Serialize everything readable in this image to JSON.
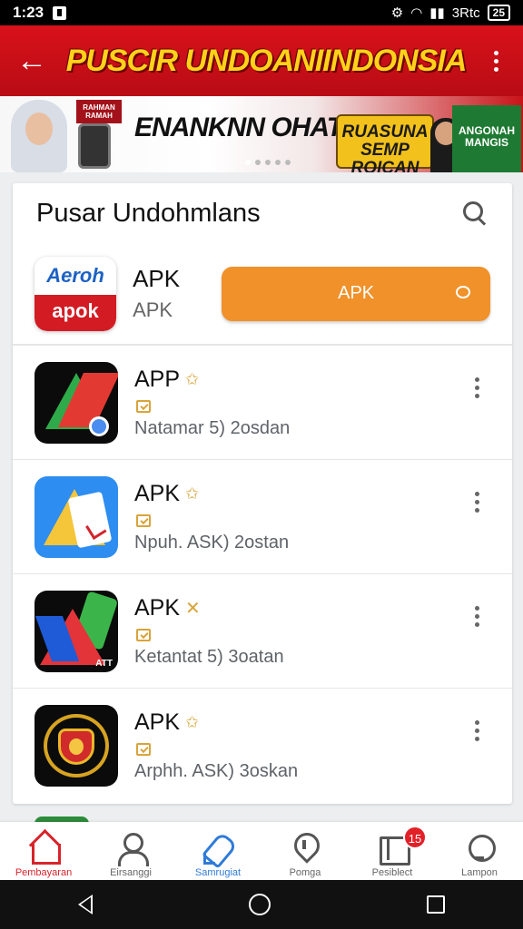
{
  "status": {
    "time": "1:23",
    "network_label": "3Rtc",
    "battery": "25"
  },
  "header": {
    "title": "PUSCIR UNDOANIINDONSIA"
  },
  "banner": {
    "left_badge": "RAHMAN RAMAH",
    "slogan": "ENANKNN OHATN",
    "yellow_box": "RUASUNA SEMP ROICAN",
    "right_box": "ANGONAH MANGIS"
  },
  "list": {
    "title": "Pusar Undohmlans",
    "featured": {
      "icon_top": "Aeroh",
      "icon_bottom": "apok",
      "name": "APK",
      "sub": "APK",
      "button_label": "APK"
    },
    "apps": [
      {
        "name": "APP",
        "badge": "star-icon",
        "desc": "Natamar 5) 2osdan"
      },
      {
        "name": "APK",
        "badge": "star-icon",
        "desc": "Npuh. ASK) 2ostan"
      },
      {
        "name": "APK",
        "badge": "x-icon",
        "desc": "Ketantat 5) 3oatan"
      },
      {
        "name": "APK",
        "badge": "star-icon",
        "desc": "Arphh. ASK) 3oskan"
      }
    ],
    "app3_icon_label": "ATT"
  },
  "bottom_nav": {
    "items": [
      {
        "label": "Pembayaran",
        "icon": "home-icon",
        "active": true
      },
      {
        "label": "Eirsanggi",
        "icon": "user-icon"
      },
      {
        "label": "Samrugiat",
        "icon": "rocket-icon"
      },
      {
        "label": "Pomga",
        "icon": "location-pin-icon"
      },
      {
        "label": "Pesiblect",
        "icon": "book-icon",
        "badge": "15"
      },
      {
        "label": "Lampon",
        "icon": "lightbulb-icon"
      }
    ]
  },
  "colors": {
    "brand_red": "#d9111b",
    "title_yellow": "#ffd21a",
    "button_orange": "#f0912a",
    "active_tab": "#d8232a"
  }
}
